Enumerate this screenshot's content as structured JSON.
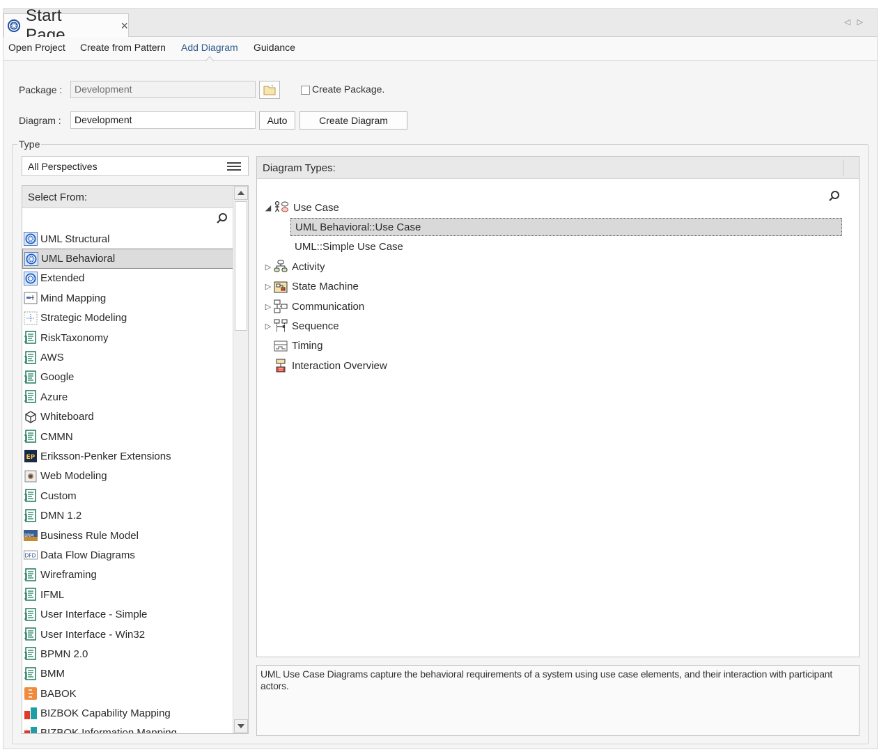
{
  "tab": {
    "title": "Start Page",
    "close": "×"
  },
  "nav_arrows": {
    "left": "◁",
    "right": "▷"
  },
  "submenu": [
    {
      "label": "Open Project"
    },
    {
      "label": "Create from Pattern"
    },
    {
      "label": "Add Diagram",
      "active": true
    },
    {
      "label": "Guidance"
    }
  ],
  "form": {
    "package_label": "Package :",
    "package_value": "Development",
    "create_package_label": "Create Package.",
    "diagram_label": "Diagram :",
    "diagram_value": "Development",
    "auto_label": "Auto",
    "create_diagram_label": "Create Diagram"
  },
  "type_group": {
    "legend": "Type",
    "perspective": "All Perspectives"
  },
  "select_from": {
    "header": "Select From:",
    "items": [
      {
        "label": "UML Structural",
        "icon": "uml-icon"
      },
      {
        "label": "UML Behavioral",
        "icon": "uml-icon",
        "selected": true
      },
      {
        "label": "Extended",
        "icon": "uml-icon"
      },
      {
        "label": "Mind Mapping",
        "icon": "mindmap-icon"
      },
      {
        "label": "Strategic Modeling",
        "icon": "strategic-icon"
      },
      {
        "label": "RiskTaxonomy",
        "icon": "mdg-icon"
      },
      {
        "label": "AWS",
        "icon": "mdg-icon"
      },
      {
        "label": "Google",
        "icon": "mdg-icon"
      },
      {
        "label": "Azure",
        "icon": "mdg-icon"
      },
      {
        "label": "Whiteboard",
        "icon": "cube-icon"
      },
      {
        "label": "CMMN",
        "icon": "mdg-icon"
      },
      {
        "label": "Eriksson-Penker Extensions",
        "icon": "ep-icon"
      },
      {
        "label": "Web Modeling",
        "icon": "web-icon"
      },
      {
        "label": "Custom",
        "icon": "mdg-icon"
      },
      {
        "label": "DMN 1.2",
        "icon": "mdg-icon"
      },
      {
        "label": "Business Rule Model",
        "icon": "brm-icon"
      },
      {
        "label": "Data Flow Diagrams",
        "icon": "dfd-icon"
      },
      {
        "label": "Wireframing",
        "icon": "mdg-icon"
      },
      {
        "label": "IFML",
        "icon": "mdg-icon"
      },
      {
        "label": "User Interface - Simple",
        "icon": "mdg-icon"
      },
      {
        "label": "User Interface - Win32",
        "icon": "mdg-icon"
      },
      {
        "label": "BPMN 2.0",
        "icon": "mdg-icon"
      },
      {
        "label": "BMM",
        "icon": "mdg-icon"
      },
      {
        "label": "BABOK",
        "icon": "babok-icon"
      },
      {
        "label": "BIZBOK Capability Mapping",
        "icon": "bizbok-icon"
      },
      {
        "label": "BIZBOK Information Mapping",
        "icon": "bizbok-icon"
      }
    ]
  },
  "diagram_types": {
    "header": "Diagram Types:",
    "tree": [
      {
        "label": "Use Case",
        "expander": "◢",
        "icon": "usecase-icon",
        "level": 0
      },
      {
        "label": "UML Behavioral::Use Case",
        "level": 1,
        "selected": true
      },
      {
        "label": "UML::Simple Use Case",
        "level": 1
      },
      {
        "label": "Activity",
        "expander": "▷",
        "icon": "activity-icon",
        "level": 0
      },
      {
        "label": "State Machine",
        "expander": "▷",
        "icon": "statemachine-icon",
        "level": 0
      },
      {
        "label": "Communication",
        "expander": "▷",
        "icon": "communication-icon",
        "level": 0
      },
      {
        "label": "Sequence",
        "expander": "▷",
        "icon": "sequence-icon",
        "level": 0
      },
      {
        "label": "Timing",
        "expander": "",
        "icon": "timing-icon",
        "level": 0
      },
      {
        "label": "Interaction Overview",
        "expander": "",
        "icon": "interaction-overview-icon",
        "level": 0
      }
    ]
  },
  "description": "UML Use Case Diagrams capture the behavioral requirements of a system using use case elements, and their interaction with participant actors.",
  "colors": {
    "accent": "#2d5b8a",
    "selection": "#dcdcdc",
    "uml_blue": "#1f5fbf"
  }
}
